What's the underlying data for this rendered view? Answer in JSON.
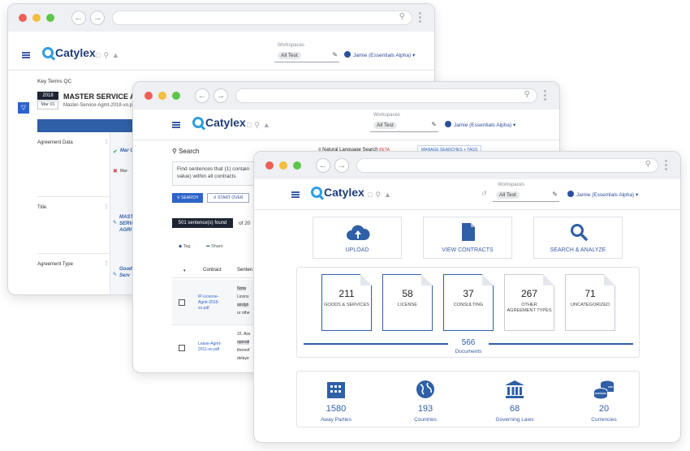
{
  "app": {
    "brand": "Catylex",
    "workspace_label": "Workspaces",
    "workspace_value": "All Test",
    "user": "Jamie (Essentials Alpha)"
  },
  "win1": {
    "page_title": "Key Terms QC",
    "year": "2018",
    "date": "Mar 01",
    "doc_title": "MASTER SERVICE AGR",
    "doc_file": "Master-Service-Agmt-2018-xo.pdf",
    "rows": [
      {
        "label": "Agreement Data",
        "snippet": "Mar C",
        "snippet2": "Mar-"
      },
      {
        "label": "Title",
        "snippet": "MAST",
        "snippet2": "SERV",
        "snippet3": "AGRI"
      },
      {
        "label": "Agreement Type",
        "snippet": "Good",
        "snippet2": "Serv"
      }
    ]
  },
  "win2": {
    "search_title": "Search",
    "nl_search": "Natural Language Search",
    "nl_badge": "BETA",
    "manage": "MANAGE SEARCHES + TAGS",
    "query": "Find sentences that (1) contain value) within all contracts",
    "search_btn": "SEARCH",
    "start_over_btn": "START OVER",
    "found": "501 sentence(s) found",
    "of_text": "of 20",
    "tag": "Tag",
    "share": "Share",
    "col_contract": "Contract",
    "col_sentence": "Senten",
    "rows": [
      {
        "contract": "IP-License-Agmt-2015-xo.pdf",
        "lines": [
          "Notw",
          "Licens",
          "assign",
          "or othe"
        ]
      },
      {
        "contract": "Lease-Agmt-2011-xo.pdf",
        "lines": [
          "22. Ass",
          "operati",
          "thereof",
          "delaye"
        ]
      }
    ]
  },
  "win3": {
    "actions": [
      {
        "label": "UPLOAD",
        "icon": "upload-cloud-icon"
      },
      {
        "label": "VIEW CONTRACTS",
        "icon": "document-icon"
      },
      {
        "label": "SEARCH & ANALYZE",
        "icon": "magnifier-icon"
      }
    ],
    "categories": [
      {
        "value": "211",
        "label": "GOODS & SERVICES"
      },
      {
        "value": "58",
        "label": "LICENSE"
      },
      {
        "value": "37",
        "label": "CONSULTING"
      },
      {
        "value": "267",
        "label": "OTHER AGREEMENT TYPES"
      },
      {
        "value": "71",
        "label": "UNCATEGORIZED"
      }
    ],
    "total_value": "566",
    "total_label": "Documents",
    "stats": [
      {
        "value": "1580",
        "label": "Away Parties",
        "icon": "building-icon"
      },
      {
        "value": "193",
        "label": "Countries",
        "icon": "globe-icon"
      },
      {
        "value": "68",
        "label": "Governing Laws",
        "icon": "courthouse-icon"
      },
      {
        "value": "20",
        "label": "Currencies",
        "icon": "coins-icon"
      }
    ]
  },
  "colors": {
    "primary": "#2f5fa6",
    "accent": "#2f9de0",
    "badge_dark": "#1d2433"
  }
}
